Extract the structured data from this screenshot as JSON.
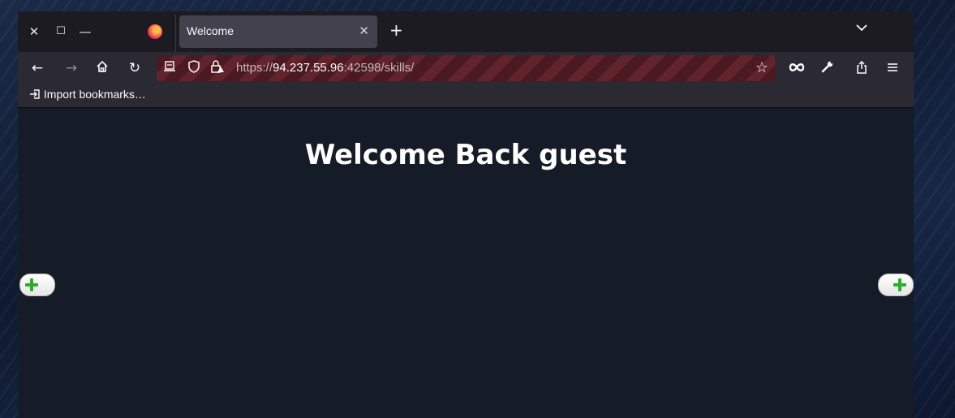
{
  "window": {
    "controls": {
      "close": "✕",
      "maximize": "☐",
      "minimize": "—"
    }
  },
  "tab": {
    "title": "Welcome",
    "close": "✕"
  },
  "tabbar": {
    "new_tab": "+",
    "list_all_tabs": "⌄"
  },
  "nav": {
    "back": "←",
    "forward": "→",
    "home": "⌂",
    "reload": "↻",
    "url_scheme": "https://",
    "url_host": "94.237.55.96",
    "url_rest": ":42598/skills/",
    "bookmark_star": "☆",
    "extensions": [
      "infinity-icon",
      "wrench-icon",
      "share-icon",
      "menu-icon"
    ]
  },
  "bookmarks": {
    "import_label": "Import bookmarks…"
  },
  "page": {
    "heading": "Welcome Back guest"
  },
  "colors": {
    "accent_plus": "#2eac2e",
    "url_bar_private": "#62242c",
    "page_bg": "#151b27"
  }
}
